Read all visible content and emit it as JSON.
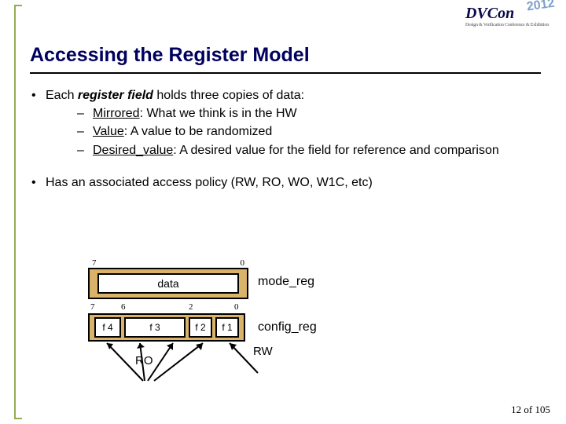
{
  "logo": {
    "brand": "DVCon",
    "tagline": "Design & Verification Conference & Exhibition",
    "year": "2012"
  },
  "title": "Accessing the Register Model",
  "bullet1": {
    "prefix": "Each ",
    "em": "register field",
    "suffix": " holds three copies of data:",
    "subs": [
      {
        "term": "Mirrored",
        "desc": ": What we think is in the HW"
      },
      {
        "term": "Value",
        "desc": ": A value to be randomized"
      },
      {
        "term": "Desired_value",
        "desc": ": A desired value for the field for reference and comparison"
      }
    ]
  },
  "bullet2": "Has an associated access policy (RW, RO, WO, W1C, etc)",
  "diagram": {
    "reg1": {
      "hi": "7",
      "lo": "0",
      "field": "data",
      "name": "mode_reg"
    },
    "reg2": {
      "bits": {
        "b7": "7",
        "b6": "6",
        "b2": "2",
        "b0": "0"
      },
      "fields": {
        "f4": "f 4",
        "f3": "f 3",
        "f2": "f 2",
        "f1": "f 1"
      },
      "name": "config_reg"
    },
    "access": {
      "ro": "RO",
      "rw": "RW"
    }
  },
  "page": "12 of 105"
}
